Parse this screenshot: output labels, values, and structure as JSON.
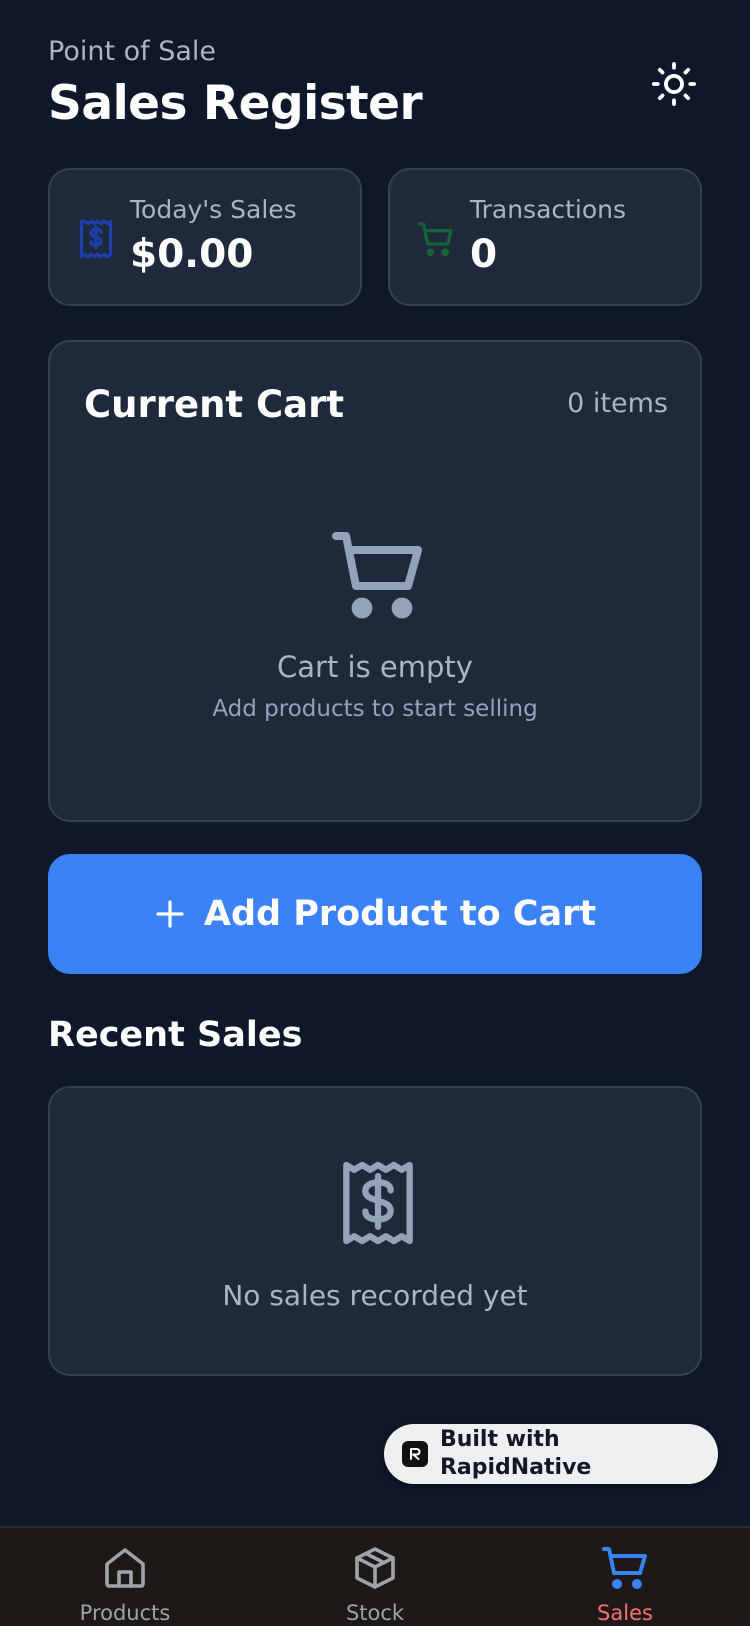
{
  "header": {
    "eyebrow": "Point of Sale",
    "title": "Sales Register",
    "theme_icon": "sun-icon"
  },
  "stats": {
    "todays_sales": {
      "label": "Today's Sales",
      "value": "$0.00",
      "icon": "receipt-dollar-icon",
      "icon_color": "#1e40af"
    },
    "transactions": {
      "label": "Transactions",
      "value": "0",
      "icon": "cart-icon",
      "icon_color": "#166534"
    }
  },
  "cart": {
    "title": "Current Cart",
    "count": "0 items",
    "empty_icon": "cart-icon",
    "empty_title": "Cart is empty",
    "empty_subtitle": "Add products to start selling"
  },
  "add_button": {
    "label": "Add Product to Cart",
    "icon": "plus-icon",
    "color": "#3b82f6"
  },
  "recent_sales": {
    "title": "Recent Sales",
    "empty_icon": "receipt-dollar-icon",
    "empty_text": "No sales recorded yet"
  },
  "badge": {
    "text": "Built with RapidNative"
  },
  "tabs": [
    {
      "label": "Products",
      "icon": "home-icon",
      "active": false
    },
    {
      "label": "Stock",
      "icon": "box-icon",
      "active": false
    },
    {
      "label": "Sales",
      "icon": "cart-icon",
      "active": true
    }
  ],
  "colors": {
    "background": "#0f172a",
    "card": "#1e293b",
    "card_border": "#334155",
    "muted_text": "#a9b4c6",
    "active_tab_icon": "#3b82f6",
    "active_tab_label": "#f87171",
    "tab_bar": "#1c1917"
  }
}
